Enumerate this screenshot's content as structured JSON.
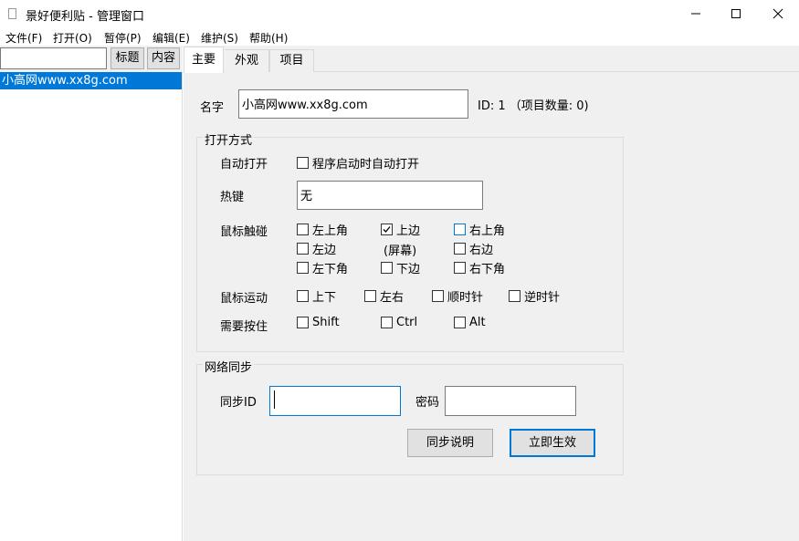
{
  "window": {
    "title": "景好便利贴 - 管理窗口"
  },
  "menu": [
    "文件(F)",
    "打开(O)",
    "暂停(P)",
    "编辑(E)",
    "维护(S)",
    "帮助(H)"
  ],
  "left": {
    "search_value": "",
    "btn_title": "标题",
    "btn_content": "内容",
    "items": [
      "小高网www.xx8g.com"
    ]
  },
  "tabs": [
    "主要",
    "外观",
    "项目"
  ],
  "main": {
    "name_label": "名字",
    "name_value": "小高网www.xx8g.com",
    "id_info": "ID: 1 （项目数量: 0)"
  },
  "open_group": {
    "title": "打开方式",
    "auto_label": "自动打开",
    "auto_cb": "程序启动时自动打开",
    "hotkey_label": "热键",
    "hotkey_value": "无",
    "touch_label": "鼠标触碰",
    "touch": {
      "top_left": "左上角",
      "top": "上边",
      "top_right": "右上角",
      "left": "左边",
      "screen": "(屏幕)",
      "right": "右边",
      "bottom_left": "左下角",
      "bottom": "下边",
      "bottom_right": "右下角"
    },
    "move_label": "鼠标运动",
    "move": {
      "updown": "上下",
      "leftright": "左右",
      "cw": "顺时针",
      "ccw": "逆时针"
    },
    "hold_label": "需要按住",
    "hold": {
      "shift": "Shift",
      "ctrl": "Ctrl",
      "alt": "Alt"
    },
    "checked": {
      "top": true
    }
  },
  "sync_group": {
    "title": "网络同步",
    "id_label": "同步ID",
    "id_value": "",
    "pwd_label": "密码",
    "pwd_value": "",
    "help_btn": "同步说明",
    "apply_btn": "立即生效"
  }
}
